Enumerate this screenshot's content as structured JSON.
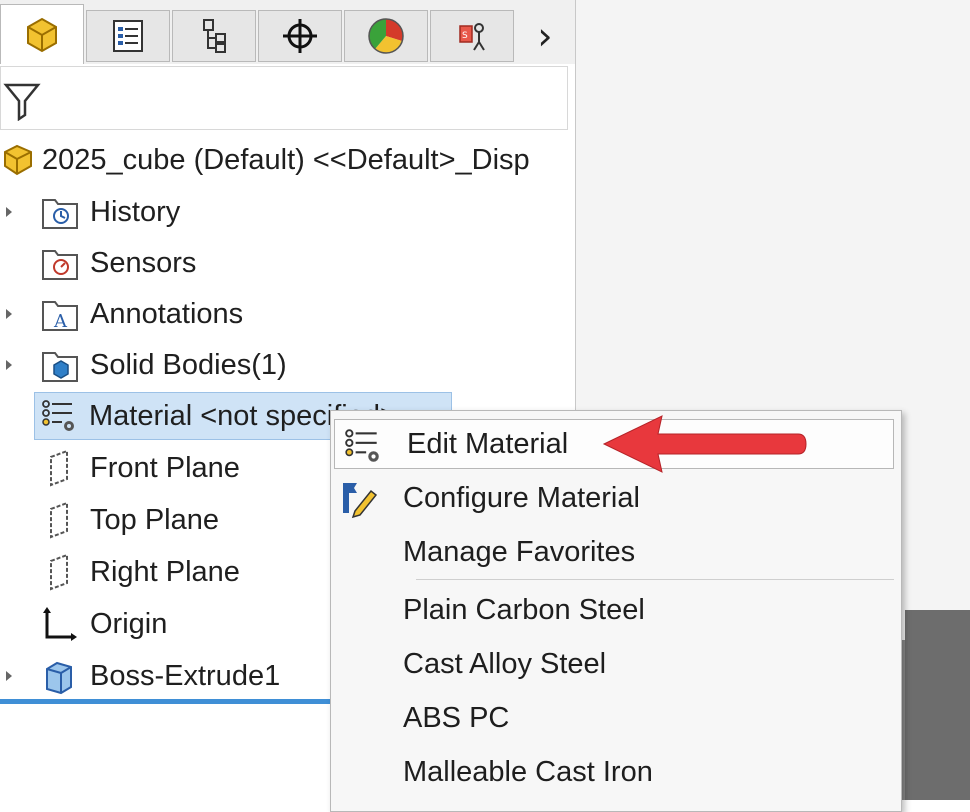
{
  "tabs": [
    {
      "name": "featuremanager-tab",
      "icon": "part-icon"
    },
    {
      "name": "propertymanager-tab",
      "icon": "property-list-icon"
    },
    {
      "name": "configuration-manager-tab",
      "icon": "configuration-icon"
    },
    {
      "name": "dimxpert-tab",
      "icon": "crosshair-icon"
    },
    {
      "name": "display-manager-tab",
      "icon": "color-wheel-icon"
    },
    {
      "name": "cam-tab",
      "icon": "cam-icon"
    }
  ],
  "tabs_more": "›",
  "tree": {
    "root_label": "2025_cube (Default) <<Default>_Disp",
    "items": [
      {
        "label": "History",
        "icon": "history-folder-icon",
        "expandable": true
      },
      {
        "label": "Sensors",
        "icon": "sensors-folder-icon",
        "expandable": false
      },
      {
        "label": "Annotations",
        "icon": "annotations-folder-icon",
        "expandable": true
      },
      {
        "label": "Solid Bodies(1)",
        "icon": "solid-bodies-folder-icon",
        "expandable": true
      },
      {
        "label": "Material  <not specified>",
        "icon": "material-icon",
        "expandable": false,
        "selected": true
      },
      {
        "label": "Front Plane",
        "icon": "plane-icon",
        "expandable": false
      },
      {
        "label": "Top Plane",
        "icon": "plane-icon",
        "expandable": false
      },
      {
        "label": "Right Plane",
        "icon": "plane-icon",
        "expandable": false
      },
      {
        "label": "Origin",
        "icon": "origin-icon",
        "expandable": false
      },
      {
        "label": "Boss-Extrude1",
        "icon": "extrude-icon",
        "expandable": true
      }
    ]
  },
  "context_menu": {
    "items": [
      {
        "label": "Edit Material",
        "icon": "material-icon",
        "highlighted": true
      },
      {
        "label": "Configure Material",
        "icon": "configure-pencil-icon"
      },
      {
        "label": "Manage Favorites"
      },
      {
        "label": "Plain Carbon Steel"
      },
      {
        "label": "Cast Alloy Steel"
      },
      {
        "label": "ABS PC"
      },
      {
        "label": "Malleable Cast Iron"
      }
    ]
  },
  "annotation": {
    "icon": "red-arrow-icon",
    "color": "#e8383d"
  },
  "colors": {
    "selection": "#cfe3f6",
    "accent_bar": "#3f8fd6"
  }
}
